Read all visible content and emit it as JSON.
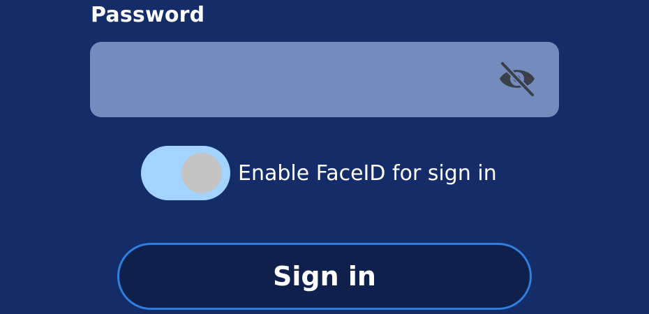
{
  "password": {
    "label": "Password",
    "value": "",
    "placeholder": "",
    "visibility_icon": "eye-off-icon"
  },
  "faceid": {
    "label": "Enable FaceID for sign in",
    "enabled": true
  },
  "actions": {
    "sign_in_label": "Sign in"
  },
  "colors": {
    "background": "#142d69",
    "field": "#738cbd",
    "toggle_track": "#a3d3ff",
    "toggle_knob": "#c4c4c4",
    "button_fill": "#10204d",
    "button_border": "#2f7fde"
  }
}
